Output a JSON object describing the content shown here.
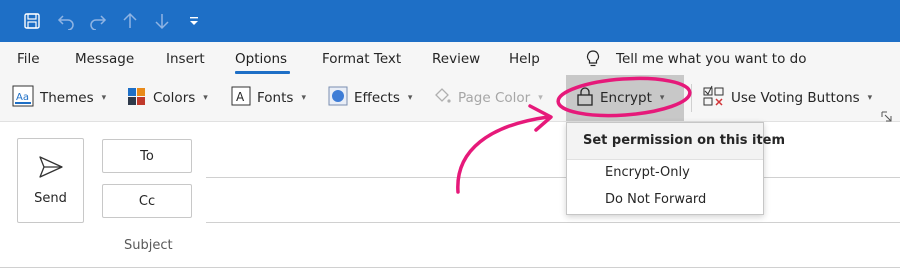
{
  "quick_access": {
    "icons": [
      "save-icon",
      "undo-icon",
      "redo-icon",
      "up-arrow-icon",
      "down-arrow-icon",
      "customize-quick-access-icon"
    ]
  },
  "menu": {
    "tabs": [
      {
        "label": "File"
      },
      {
        "label": "Message"
      },
      {
        "label": "Insert"
      },
      {
        "label": "Options",
        "active": true
      },
      {
        "label": "Format Text"
      },
      {
        "label": "Review"
      },
      {
        "label": "Help"
      }
    ],
    "tell_me": "Tell me what you want to do"
  },
  "ribbon": {
    "themes": "Themes",
    "colors": "Colors",
    "fonts": "Fonts",
    "effects": "Effects",
    "page_color": "Page Color",
    "encrypt": "Encrypt",
    "voting": "Use Voting Buttons"
  },
  "compose": {
    "send": "Send",
    "to": "To",
    "cc": "Cc",
    "subject": "Subject"
  },
  "encrypt_menu": {
    "header": "Set permission on this item",
    "items": [
      "Encrypt-Only",
      "Do Not Forward"
    ]
  },
  "colors": {
    "title_bar": "#1e6fc6",
    "annotation": "#e6197a",
    "ribbon_bg": "#f6f6f6"
  }
}
